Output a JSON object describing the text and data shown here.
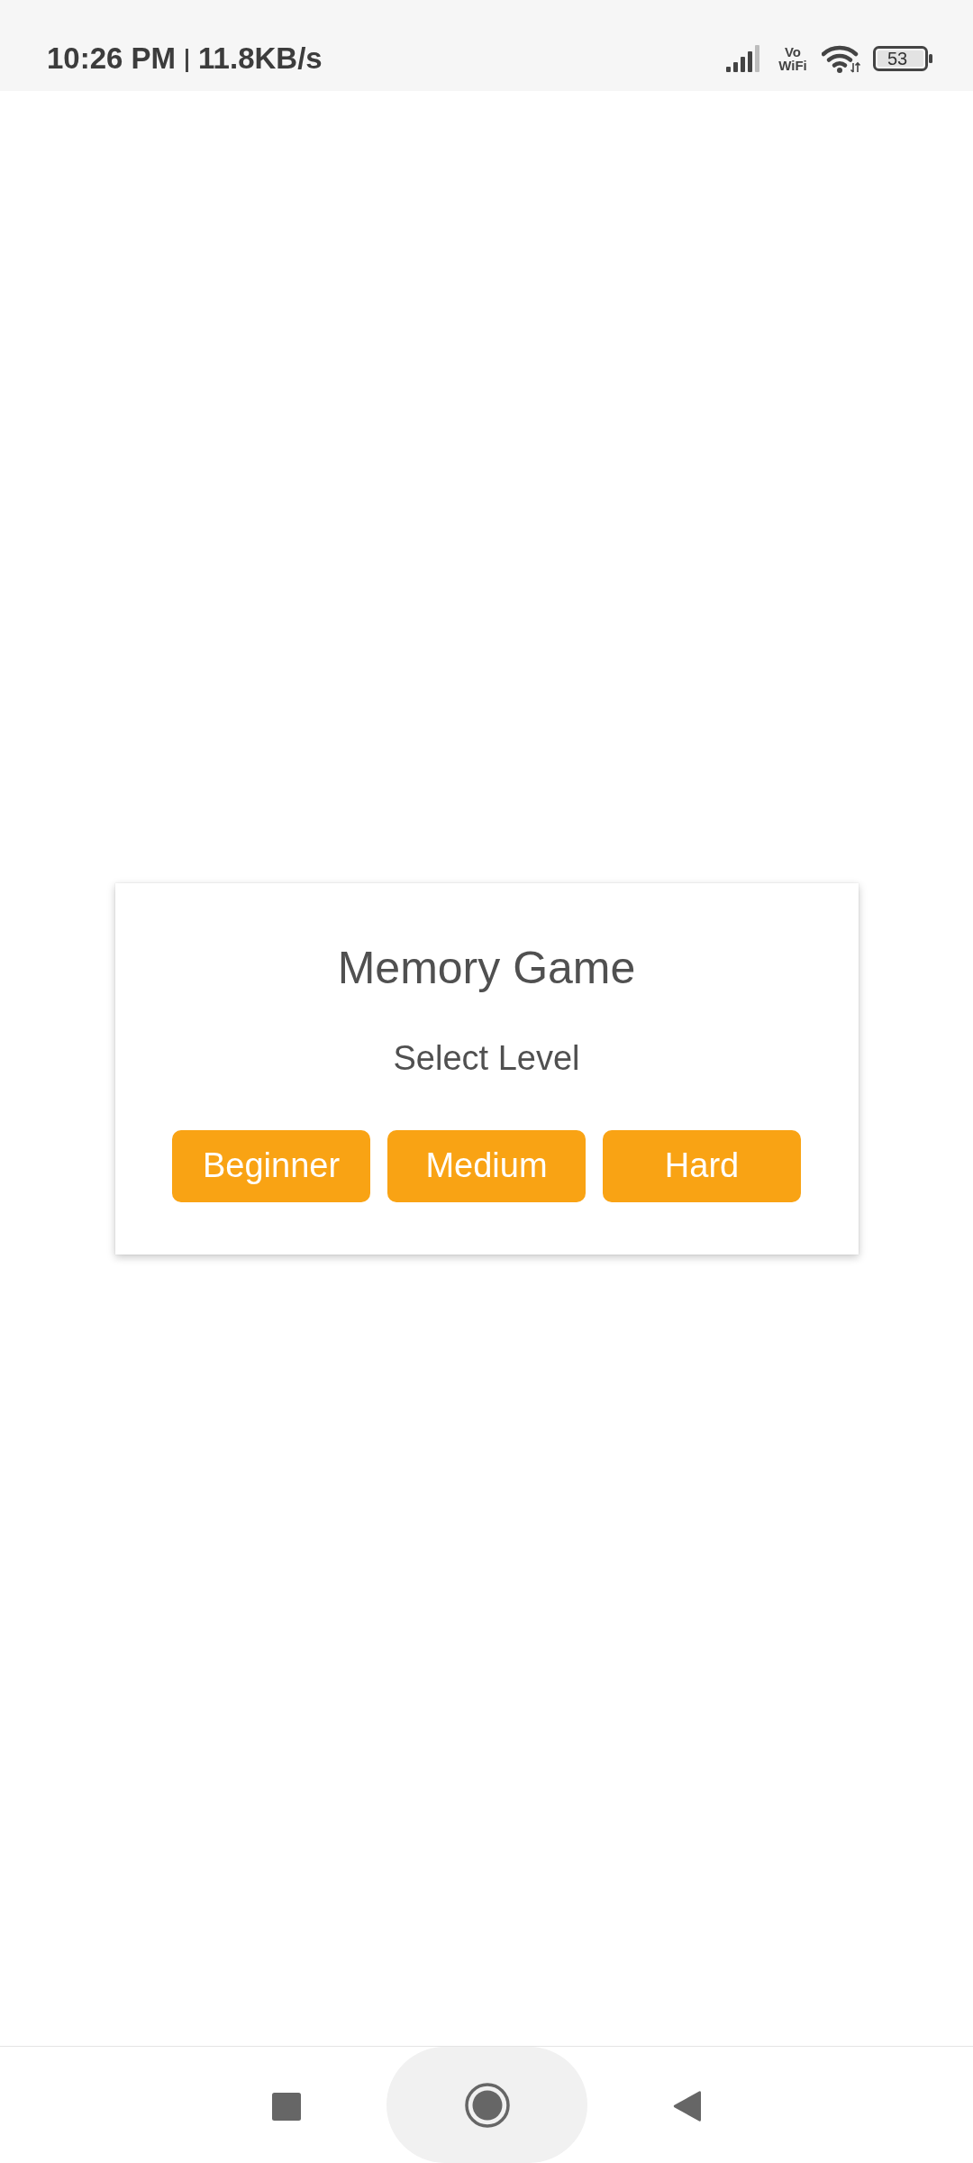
{
  "status_bar": {
    "time": "10:26 PM",
    "network_speed": "11.8KB/s",
    "vowifi_label": "Vo WiFi",
    "battery": "53"
  },
  "dialog": {
    "title": "Memory Game",
    "subtitle": "Select Level",
    "level_buttons": [
      "Beginner",
      "Medium",
      "Hard"
    ]
  },
  "navigation_bar": {
    "buttons": [
      {
        "kind": "recents"
      },
      {
        "kind": "home"
      },
      {
        "kind": "back"
      }
    ]
  }
}
